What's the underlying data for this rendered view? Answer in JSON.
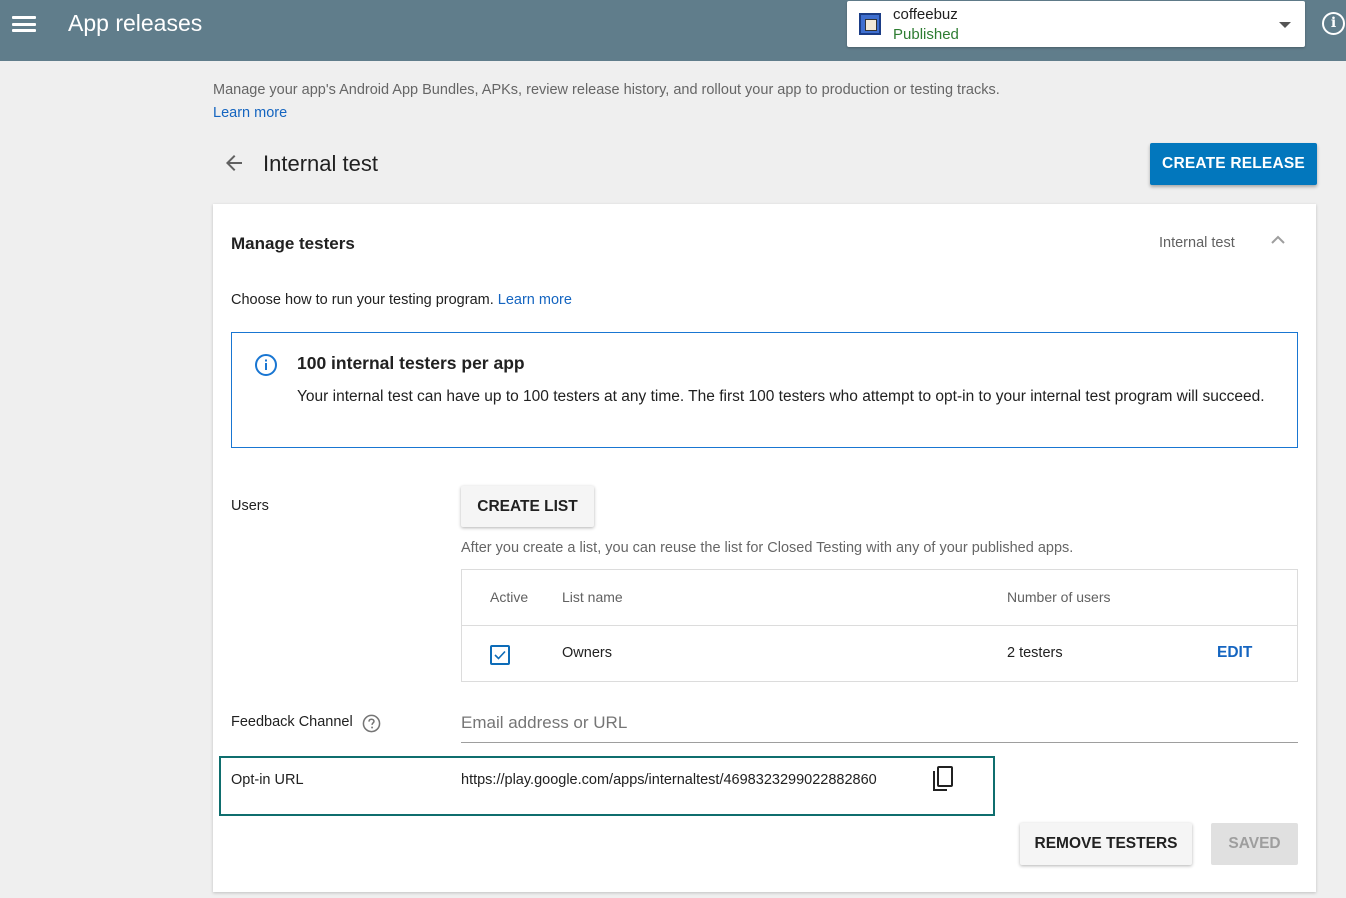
{
  "header": {
    "title": "App releases",
    "app": {
      "name": "coffeebuz",
      "status": "Published"
    }
  },
  "page": {
    "description": "Manage your app's Android App Bundles, APKs, review release history, and rollout your app to production or testing tracks.",
    "learn_more": "Learn more",
    "heading": "Internal test",
    "create_release": "CREATE RELEASE"
  },
  "card": {
    "title": "Manage testers",
    "track": "Internal test",
    "choose_text": "Choose how to run your testing program.",
    "learn_more": "Learn more",
    "info": {
      "title": "100 internal testers per app",
      "body": "Your internal test can have up to 100 testers at any time. The first 100 testers who attempt to opt-in to your internal test program will succeed."
    },
    "users": {
      "label": "Users",
      "create_list": "CREATE LIST",
      "hint": "After you create a list, you can reuse the list for Closed Testing with any of your published apps.",
      "columns": {
        "active": "Active",
        "list_name": "List name",
        "number_of_users": "Number of users"
      },
      "rows": [
        {
          "active": true,
          "list_name": "Owners",
          "count": "2 testers",
          "action": "EDIT"
        }
      ]
    },
    "feedback": {
      "label": "Feedback Channel",
      "placeholder": "Email address or URL",
      "value": ""
    },
    "optin": {
      "label": "Opt-in URL",
      "url": "https://play.google.com/apps/internaltest/4698323299022882860"
    },
    "actions": {
      "remove_testers": "REMOVE TESTERS",
      "saved": "SAVED"
    }
  },
  "colors": {
    "topbar": "#607d8b",
    "primary": "#0277bd",
    "link": "#1565c0",
    "published": "#2e7d32",
    "info_border": "#1976d2",
    "optin_border": "#0f6e6e"
  },
  "icons": {
    "menu": "menu-icon",
    "info_top": "info-icon",
    "back": "arrow-back-icon",
    "collapse": "chevron-up-icon",
    "info_box": "info-icon",
    "help": "help-icon",
    "copy": "copy-icon",
    "check": "check-icon",
    "dropdown": "caret-down-icon"
  }
}
